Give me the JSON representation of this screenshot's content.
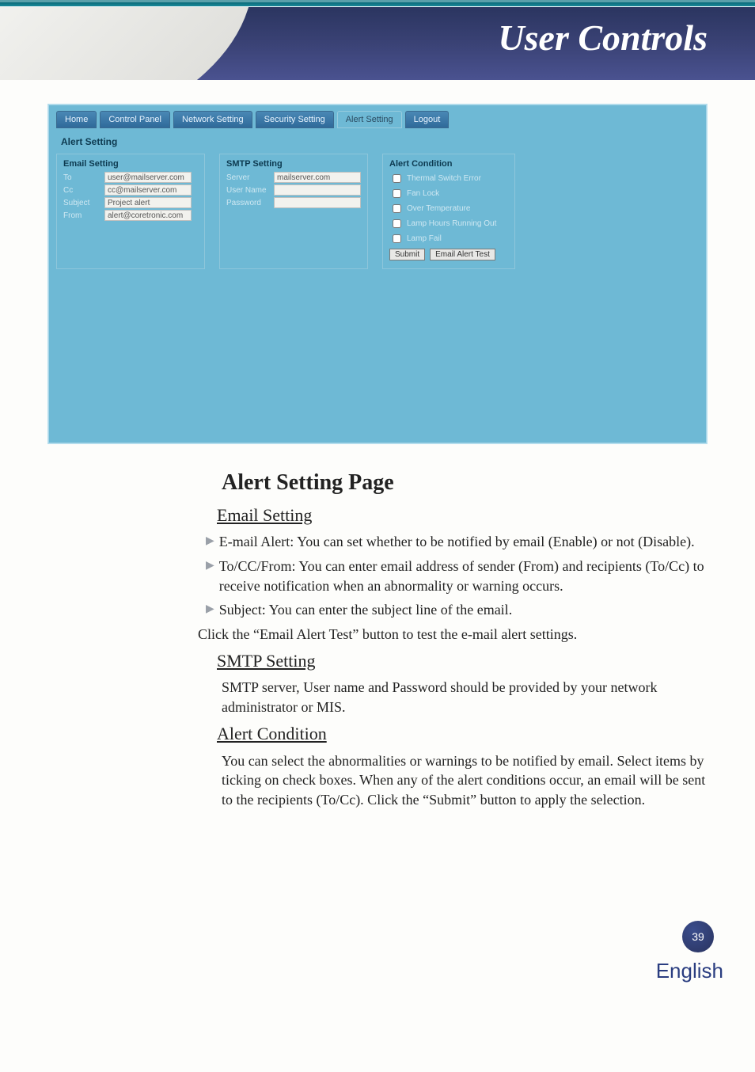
{
  "header": {
    "title": "User Controls"
  },
  "screenshot": {
    "tabs": [
      "Home",
      "Control Panel",
      "Network Setting",
      "Security Setting",
      "Alert Setting",
      "Logout"
    ],
    "active_tab_index": 4,
    "section": "Alert Setting",
    "email_setting": {
      "title": "Email Setting",
      "to_label": "To",
      "to": "user@mailserver.com",
      "cc_label": "Cc",
      "cc": "cc@mailserver.com",
      "subject_label": "Subject",
      "subject": "Project alert",
      "from_label": "From",
      "from": "alert@coretronic.com"
    },
    "smtp_setting": {
      "title": "SMTP Setting",
      "server_label": "Server",
      "server": "mailserver.com",
      "user_label": "User Name",
      "user": "",
      "password_label": "Password",
      "password": ""
    },
    "alert_condition": {
      "title": "Alert Condition",
      "items": [
        "Thermal Switch Error",
        "Fan Lock",
        "Over Temperature",
        "Lamp Hours Running Out",
        "Lamp Fail"
      ],
      "submit": "Submit",
      "test": "Email Alert Test"
    }
  },
  "body": {
    "h2": "Alert Setting Page",
    "email_h3": "Email Setting",
    "b1": "E-mail Alert: You can set whether to be notified by email (Enable) or not (Disable).",
    "b2": "To/CC/From: You can enter email address of sender (From) and recipients (To/Cc) to receive notification when an abnormality or warning occurs.",
    "b3": "Subject: You can enter the subject line of the email.",
    "p1": "Click the “Email Alert Test” button to test the e-mail alert settings.",
    "smtp_h3": "SMTP Setting",
    "p2": "SMTP server, User name and Password should be provided by your network administrator or MIS.",
    "alert_h3": "Alert Condition",
    "p3": "You can select the abnormalities or warnings to be notified by email. Select items by ticking on check boxes. When any of the alert conditions occur, an email will be sent to the recipients (To/Cc). Click the “Submit” button to apply the selection."
  },
  "footer": {
    "page": "39",
    "language": "English"
  }
}
